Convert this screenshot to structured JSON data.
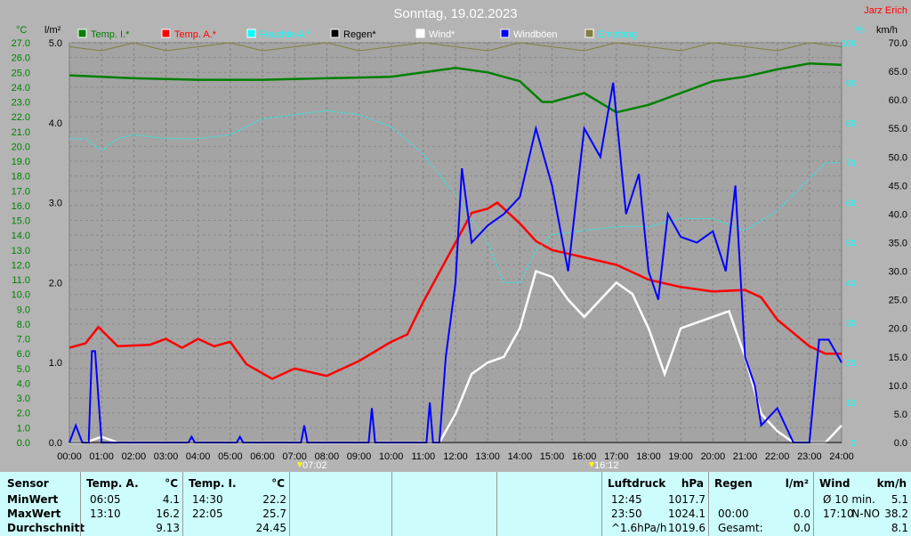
{
  "title": "Sonntag, 19.02.2023",
  "author": "Jarz Erich",
  "units": {
    "temp": "°C",
    "rain": "l/m²",
    "hum": "%",
    "wind": "km/h"
  },
  "legend": [
    {
      "label": "Temp. I.*",
      "color": "#008000",
      "text": "#008000"
    },
    {
      "label": "Temp. A.*",
      "color": "#ff0000",
      "text": "#ff0000"
    },
    {
      "label": "Feuchte A.*",
      "color": "#00ffff",
      "text": "#00ffff"
    },
    {
      "label": "Regen*",
      "color": "#000000",
      "text": "#000000"
    },
    {
      "label": "Wind*",
      "color": "#ffffff",
      "text": "#ffffff"
    },
    {
      "label": "Windböen",
      "color": "#0000ff",
      "text": "#ffffff"
    },
    {
      "label": "Empfang",
      "color": "#808040",
      "text": "#00ffff"
    }
  ],
  "markers": {
    "sunrise": "07:02",
    "sunset": "16:12"
  },
  "chart_data": {
    "type": "line",
    "title": "Sonntag, 19.02.2023",
    "x_ticks": [
      "00:00",
      "01:00",
      "02:00",
      "03:00",
      "04:00",
      "05:00",
      "06:00",
      "07:00",
      "08:00",
      "09:00",
      "10:00",
      "11:00",
      "12:00",
      "13:00",
      "14:00",
      "15:00",
      "16:00",
      "17:00",
      "18:00",
      "19:00",
      "20:00",
      "21:00",
      "22:00",
      "23:00",
      "24:00"
    ],
    "axes": {
      "temp": [
        0,
        27
      ],
      "rain": [
        0,
        5
      ],
      "hum": [
        0,
        100
      ],
      "wind": [
        0,
        70
      ]
    },
    "series": [
      {
        "name": "Temp. I.*",
        "axis": "temp",
        "color": "#008000",
        "x": [
          0,
          2,
          4,
          6,
          8,
          10,
          11,
          12,
          13,
          14,
          14.7,
          15,
          16,
          17,
          18,
          19,
          20,
          21,
          22,
          23,
          24
        ],
        "y": [
          24.8,
          24.6,
          24.5,
          24.5,
          24.6,
          24.7,
          25.0,
          25.3,
          25.0,
          24.4,
          23.0,
          23.0,
          23.6,
          22.3,
          22.8,
          23.6,
          24.4,
          24.7,
          25.2,
          25.6,
          25.5
        ]
      },
      {
        "name": "Temp. A.*",
        "axis": "temp",
        "color": "#ff0000",
        "x": [
          0,
          0.5,
          0.9,
          1.5,
          2.5,
          3,
          3.5,
          4,
          4.5,
          5,
          5.5,
          6.3,
          7,
          8,
          9,
          10,
          10.5,
          11,
          11.5,
          12,
          12.5,
          13,
          13.3,
          14,
          14.5,
          15,
          16,
          17,
          18,
          19,
          20,
          21,
          21.5,
          22,
          23,
          23.5,
          24
        ],
        "y": [
          6.4,
          6.7,
          7.8,
          6.5,
          6.6,
          7.0,
          6.4,
          7.0,
          6.5,
          6.8,
          5.3,
          4.3,
          5.0,
          4.5,
          5.5,
          6.8,
          7.3,
          9.5,
          11.5,
          13.5,
          15.5,
          15.8,
          16.2,
          14.8,
          13.6,
          13.0,
          12.5,
          12.0,
          11.0,
          10.5,
          10.2,
          10.3,
          9.8,
          8.3,
          6.5,
          6.0,
          6.0
        ]
      },
      {
        "name": "Feuchte A.*",
        "axis": "hum",
        "color": "#00ffff",
        "dashed": true,
        "x": [
          0,
          0.5,
          1,
          1.5,
          2,
          3,
          4,
          5,
          6,
          7,
          8,
          9,
          10,
          11,
          12,
          13,
          13.5,
          14,
          14.5,
          15,
          16,
          17,
          18,
          19,
          20,
          21,
          22,
          23,
          23.5,
          24
        ],
        "y": [
          76,
          76,
          73,
          76,
          77,
          76,
          76,
          77,
          81,
          82,
          83,
          82,
          79,
          72,
          62,
          50,
          40,
          40,
          48,
          52,
          53,
          54,
          54,
          56,
          56,
          53,
          58,
          66,
          70,
          70
        ]
      },
      {
        "name": "Wind*",
        "axis": "wind",
        "color": "#ffffff",
        "x": [
          0,
          0.5,
          1,
          1.5,
          11.5,
          12,
          12.5,
          13,
          13.5,
          14,
          14.5,
          15,
          15.5,
          16,
          16.5,
          17,
          17.5,
          18,
          18.5,
          19,
          20,
          20.5,
          21,
          21.5,
          22,
          22.5,
          23.5,
          24
        ],
        "y": [
          0,
          0,
          1,
          0,
          0,
          5,
          12,
          14,
          15,
          20,
          30,
          29,
          25,
          22,
          25,
          28,
          26,
          20,
          12,
          20,
          22,
          23,
          15,
          5,
          2,
          0,
          0,
          3
        ]
      },
      {
        "name": "Windböen",
        "axis": "wind",
        "color": "#0000ff",
        "x": [
          0,
          0.2,
          0.4,
          0.6,
          0.7,
          0.8,
          1,
          3.7,
          3.8,
          3.9,
          5.2,
          5.3,
          5.4,
          7.2,
          7.3,
          7.4,
          9.3,
          9.4,
          9.5,
          11.1,
          11.2,
          11.3,
          11.5,
          11.7,
          12,
          12.2,
          12.5,
          13,
          13.5,
          14,
          14.5,
          15,
          15.5,
          16,
          16.5,
          16.9,
          17.3,
          17.7,
          18,
          18.3,
          18.6,
          19,
          19.5,
          20,
          20.4,
          20.7,
          21,
          21.3,
          21.5,
          22,
          22.5,
          23,
          23.3,
          23.6,
          24
        ],
        "y": [
          0,
          3,
          0,
          0,
          16,
          16,
          0,
          0,
          1,
          0,
          0,
          1,
          0,
          0,
          3,
          0,
          0,
          6,
          0,
          0,
          7,
          0,
          0,
          15,
          28,
          48,
          35,
          38,
          40,
          43,
          55,
          45,
          30,
          55,
          50,
          63,
          40,
          47,
          30,
          25,
          40,
          36,
          35,
          37,
          30,
          45,
          15,
          10,
          3,
          6,
          0,
          0,
          18,
          18,
          14
        ]
      },
      {
        "name": "Empfang",
        "axis": "hum",
        "color": "#808040",
        "x": [
          0,
          1,
          2,
          3,
          4,
          5,
          6,
          7,
          8,
          9,
          10,
          11,
          12,
          13,
          14,
          15,
          16,
          17,
          18,
          19,
          20,
          21,
          22,
          23,
          24
        ],
        "y": [
          99,
          98,
          100,
          98,
          99,
          100,
          98,
          99,
          100,
          98,
          99,
          100,
          99,
          98,
          100,
          99,
          98,
          100,
          99,
          98,
          100,
          99,
          98,
          100,
          99
        ]
      },
      {
        "name": "Regen*",
        "axis": "rain",
        "color": "#000000",
        "x": [
          0,
          24
        ],
        "y": [
          0,
          0
        ]
      }
    ]
  },
  "table": {
    "sensor": {
      "h": "Sensor",
      "rows": [
        "MinWert",
        "MaxWert",
        "Durchschnitt"
      ]
    },
    "tempA": {
      "h": "Temp. A.",
      "u": "°C",
      "t": [
        "06:05",
        "13:10",
        ""
      ],
      "v": [
        "4.1",
        "16.2",
        "9.13"
      ]
    },
    "tempI": {
      "h": "Temp. I.",
      "u": "°C",
      "t": [
        "14:30",
        "22:05",
        ""
      ],
      "v": [
        "22.2",
        "25.7",
        "24.45"
      ]
    },
    "druck": {
      "h": "Luftdruck",
      "u": "hPa",
      "t": [
        "12:45",
        "23:50",
        "^1.6hPa/h"
      ],
      "v": [
        "1017.7",
        "1024.1",
        "1019.6"
      ]
    },
    "regen": {
      "h": "Regen",
      "u": "l/m²",
      "t": [
        "",
        "00:00",
        "Gesamt:"
      ],
      "v": [
        "",
        "0.0",
        "0.0"
      ]
    },
    "wind": {
      "h": "Wind",
      "u": "km/h",
      "t": [
        "Ø 10 min.",
        "17:10",
        ""
      ],
      "d": [
        "",
        "N-NO",
        ""
      ],
      "v": [
        "5.1",
        "38.2",
        "8.1"
      ]
    }
  }
}
